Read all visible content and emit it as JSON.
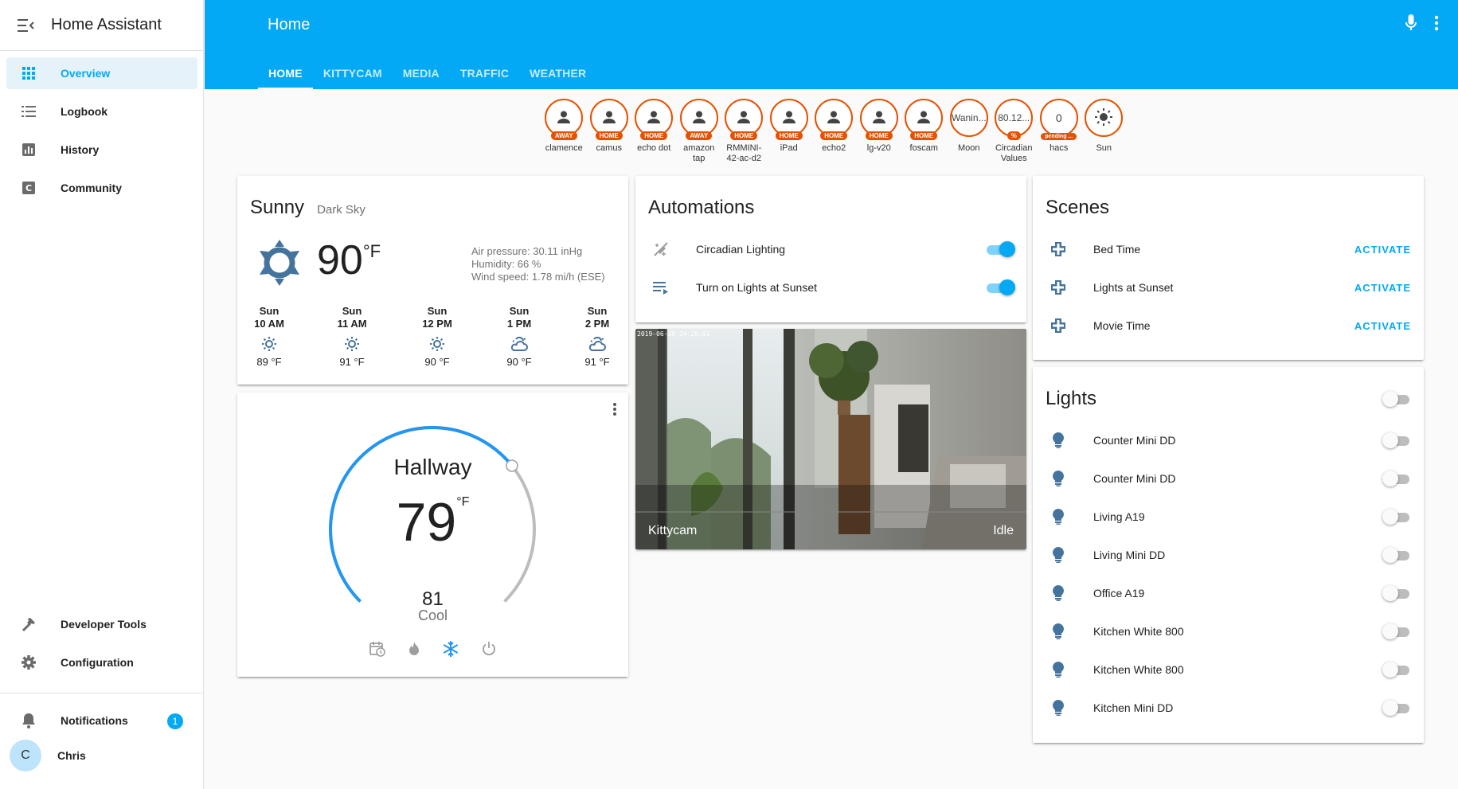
{
  "app": {
    "title": "Home Assistant"
  },
  "sidebar": {
    "items": [
      {
        "label": "Overview",
        "icon": "grid-icon"
      },
      {
        "label": "Logbook",
        "icon": "list-icon"
      },
      {
        "label": "History",
        "icon": "chart-icon"
      },
      {
        "label": "Community",
        "icon": "community-icon"
      }
    ],
    "bottom": [
      {
        "label": "Developer Tools",
        "icon": "hammer-icon"
      },
      {
        "label": "Configuration",
        "icon": "gear-icon"
      }
    ],
    "notifications": {
      "label": "Notifications",
      "count": "1"
    },
    "user": {
      "name": "Chris",
      "initial": "C"
    }
  },
  "header": {
    "title": "Home",
    "tabs": [
      "HOME",
      "KITTYCAM",
      "MEDIA",
      "TRAFFIC",
      "WEATHER"
    ]
  },
  "badges": [
    {
      "value": "",
      "label": "AWAY",
      "name": "clamence",
      "icon": "person-icon"
    },
    {
      "value": "",
      "label": "HOME",
      "name": "camus",
      "icon": "person-icon"
    },
    {
      "value": "",
      "label": "HOME",
      "name": "echo dot",
      "icon": "person-icon"
    },
    {
      "value": "",
      "label": "AWAY",
      "name": "amazon tap",
      "icon": "person-icon"
    },
    {
      "value": "",
      "label": "HOME",
      "name": "RMMINI-42-ac-d2",
      "icon": "person-icon"
    },
    {
      "value": "",
      "label": "HOME",
      "name": "iPad",
      "icon": "person-icon"
    },
    {
      "value": "",
      "label": "HOME",
      "name": "echo2",
      "icon": "person-icon"
    },
    {
      "value": "",
      "label": "HOME",
      "name": "lg-v20",
      "icon": "person-icon"
    },
    {
      "value": "",
      "label": "HOME",
      "name": "foscam",
      "icon": "person-icon"
    },
    {
      "value": "Wanin...",
      "label": "",
      "name": "Moon",
      "icon": ""
    },
    {
      "value": "80.12...",
      "label": "%",
      "name": "Circadian Values",
      "icon": ""
    },
    {
      "value": "0",
      "label": "pending ...",
      "name": "hacs",
      "icon": ""
    },
    {
      "value": "",
      "label": "",
      "name": "Sun",
      "icon": "sun-icon"
    }
  ],
  "weather": {
    "condition": "Sunny",
    "source": "Dark Sky",
    "temp": "90",
    "unit": "°F",
    "pressure": "Air pressure: 30.11 inHg",
    "humidity": "Humidity: 66 %",
    "wind": "Wind speed: 1.78 mi/h (ESE)",
    "forecast": [
      {
        "day": "Sun",
        "time": "10 AM",
        "temp": "89 °F",
        "icon": "sunny-icon"
      },
      {
        "day": "Sun",
        "time": "11 AM",
        "temp": "91 °F",
        "icon": "sunny-icon"
      },
      {
        "day": "Sun",
        "time": "12 PM",
        "temp": "90 °F",
        "icon": "sunny-icon"
      },
      {
        "day": "Sun",
        "time": "1 PM",
        "temp": "90 °F",
        "icon": "partly-cloudy-icon"
      },
      {
        "day": "Sun",
        "time": "2 PM",
        "temp": "91 °F",
        "icon": "partly-cloudy-icon"
      }
    ]
  },
  "thermostat": {
    "name": "Hallway",
    "current": "79",
    "unit": "°F",
    "target": "81",
    "mode": "Cool",
    "level": 0.69
  },
  "automations": {
    "title": "Automations",
    "items": [
      {
        "name": "Circadian Lighting",
        "state": "on",
        "icon": "theme-light-dark-icon"
      },
      {
        "name": "Turn on Lights at Sunset",
        "state": "on",
        "icon": "playlist-play-icon"
      }
    ]
  },
  "camera": {
    "name": "Kittycam",
    "state": "Idle",
    "timestamp": "2019-06-20  14:29:51"
  },
  "scenes": {
    "title": "Scenes",
    "activate": "ACTIVATE",
    "items": [
      "Bed Time",
      "Lights at Sunset",
      "Movie Time"
    ]
  },
  "lights": {
    "title": "Lights",
    "items": [
      "Counter Mini DD",
      "Counter Mini DD",
      "Living A19",
      "Living Mini DD",
      "Office A19",
      "Kitchen White 800",
      "Kitchen White 800",
      "Kitchen Mini DD"
    ]
  },
  "colors": {
    "primary": "#03a9f4",
    "badge": "#e65100",
    "icon": "#44739e"
  }
}
